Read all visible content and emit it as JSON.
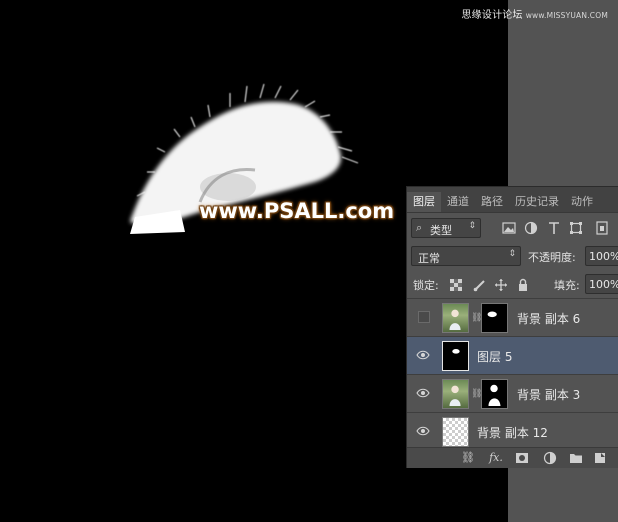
{
  "watermark_top": {
    "text": "思缘设计论坛",
    "site": "www.MISSYUAN.COM"
  },
  "watermark_main": "www.PSALL.com",
  "panel": {
    "tabs": [
      "图层",
      "通道",
      "路径",
      "历史记录",
      "动作"
    ],
    "filter_label": "类型",
    "blend_mode": "正常",
    "opacity_label": "不透明度:",
    "opacity_value": "100%",
    "lock_label": "锁定:",
    "fill_label": "填充:",
    "fill_value": "100%",
    "layers": [
      {
        "name": "背景 副本 6",
        "visible": false
      },
      {
        "name": "图层 5",
        "visible": true,
        "selected": true
      },
      {
        "name": "背景 副本 3",
        "visible": true
      },
      {
        "name": "背景 副本 12",
        "visible": true
      }
    ],
    "footer_icons": [
      "link-icon",
      "fx-icon",
      "mask-icon",
      "adjustment-icon",
      "folder-icon",
      "new-layer-icon",
      "trash-icon"
    ]
  }
}
